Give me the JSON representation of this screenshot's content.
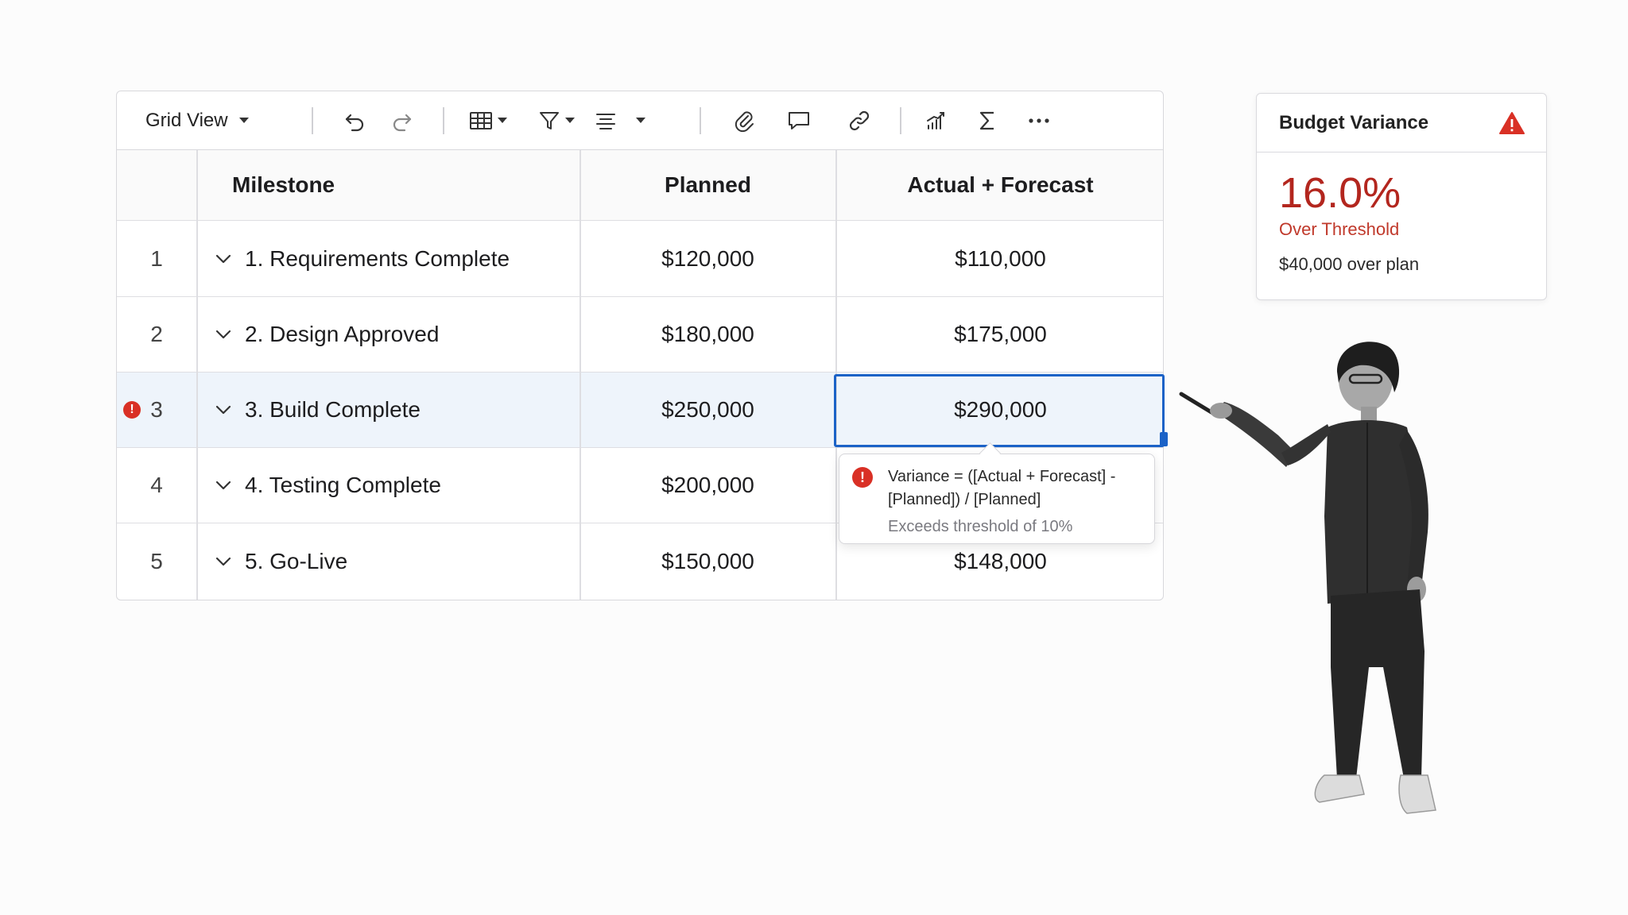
{
  "toolbar": {
    "view_label": "Grid View"
  },
  "table": {
    "headers": {
      "milestone": "Milestone",
      "planned": "Planned",
      "actual_forecast": "Actual + Forecast"
    },
    "rows": [
      {
        "num": "1",
        "milestone": "1. Requirements Complete",
        "planned": "$120,000",
        "actual_forecast": "$110,000"
      },
      {
        "num": "2",
        "milestone": "2. Design Approved",
        "planned": "$180,000",
        "actual_forecast": "$175,000"
      },
      {
        "num": "3",
        "milestone": "3. Build Complete",
        "planned": "$250,000",
        "actual_forecast": "$290,000"
      },
      {
        "num": "4",
        "milestone": "4. Testing Complete",
        "planned": "$200,000",
        "actual_forecast": ""
      },
      {
        "num": "5",
        "milestone": "5. Go-Live",
        "planned": "$150,000",
        "actual_forecast": "$148,000"
      }
    ]
  },
  "tooltip": {
    "formula_line1": "Variance =   ([Actual + Forecast] -",
    "formula_line2": "[Planned]) / [Planned]",
    "note": "Exceeds threshold of 10%"
  },
  "card": {
    "title": "Budget Variance",
    "percent": "16.0%",
    "status": "Over Threshold",
    "detail": "$40,000 over plan"
  },
  "colors": {
    "accent_blue": "#1b62c7",
    "error_red": "#d93025",
    "variance_red": "#b3261e"
  },
  "icons": [
    "chevron-down-icon",
    "undo-icon",
    "redo-icon",
    "table-icon",
    "filter-icon",
    "align-icon",
    "paperclip-icon",
    "comment-icon",
    "link-icon",
    "chart-icon",
    "sigma-icon",
    "more-icon",
    "warning-icon",
    "error-icon"
  ]
}
